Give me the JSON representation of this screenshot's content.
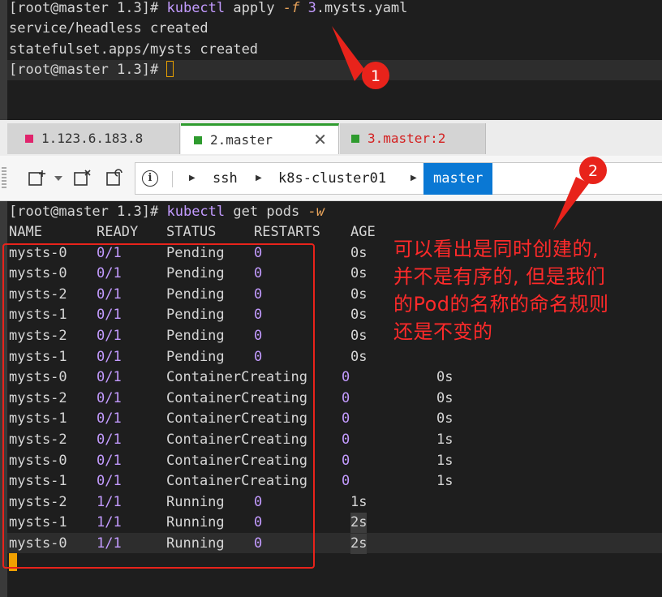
{
  "top_terminal": {
    "lines": [
      {
        "prompt": "[root@master 1.3]#",
        "cmd": "kubectl",
        "args": "apply",
        "flag": "-f",
        "num": "3",
        "rest": ".mysts.yaml"
      },
      {
        "text": "service/headless created"
      },
      {
        "text": "statefulset.apps/mysts created"
      },
      {
        "prompt": "[root@master 1.3]#"
      }
    ]
  },
  "tabs": [
    {
      "label": "1.123.6.183.8",
      "color": "#e0246c"
    },
    {
      "label": "2.master",
      "color": "#2e9b2e",
      "close": "✕"
    },
    {
      "label": "3.master:2",
      "color": "#2e9b2e",
      "label_color": "#d42020"
    }
  ],
  "toolbar": {
    "icons": [
      "new-tab-icon",
      "dropdown-arrow-icon",
      "close-tab-icon",
      "refresh-tab-icon"
    ],
    "info": "i",
    "breadcrumbs": [
      "ssh",
      "k8s-cluster01",
      "master"
    ]
  },
  "bottom_terminal": {
    "prompt": "[root@master 1.3]#",
    "cmd": "kubectl",
    "args": "get pods",
    "flag": "-w",
    "header": [
      "NAME",
      "READY",
      "STATUS",
      "RESTARTS",
      "AGE"
    ],
    "rows": [
      [
        "mysts-0",
        "0/1",
        "Pending",
        "0",
        "0s"
      ],
      [
        "mysts-0",
        "0/1",
        "Pending",
        "0",
        "0s"
      ],
      [
        "mysts-2",
        "0/1",
        "Pending",
        "0",
        "0s"
      ],
      [
        "mysts-1",
        "0/1",
        "Pending",
        "0",
        "0s"
      ],
      [
        "mysts-2",
        "0/1",
        "Pending",
        "0",
        "0s"
      ],
      [
        "mysts-1",
        "0/1",
        "Pending",
        "0",
        "0s"
      ],
      [
        "mysts-0",
        "0/1",
        "ContainerCreating",
        "0",
        "0s"
      ],
      [
        "mysts-2",
        "0/1",
        "ContainerCreating",
        "0",
        "0s"
      ],
      [
        "mysts-1",
        "0/1",
        "ContainerCreating",
        "0",
        "0s"
      ],
      [
        "mysts-2",
        "0/1",
        "ContainerCreating",
        "0",
        "1s"
      ],
      [
        "mysts-0",
        "0/1",
        "ContainerCreating",
        "0",
        "1s"
      ],
      [
        "mysts-1",
        "0/1",
        "ContainerCreating",
        "0",
        "1s"
      ],
      [
        "mysts-2",
        "1/1",
        "Running",
        "0",
        "1s"
      ],
      [
        "mysts-1",
        "1/1",
        "Running",
        "0",
        "2s"
      ],
      [
        "mysts-0",
        "1/1",
        "Running",
        "0",
        "2s"
      ]
    ]
  },
  "annotations": {
    "callout1": "1",
    "callout2": "2",
    "note_lines": [
      "可以看出是同时创建的,",
      "并不是有序的, 但是我们",
      "的Pod的名称的命名规则",
      "还是不变的"
    ],
    "accent": "#e8231b"
  }
}
